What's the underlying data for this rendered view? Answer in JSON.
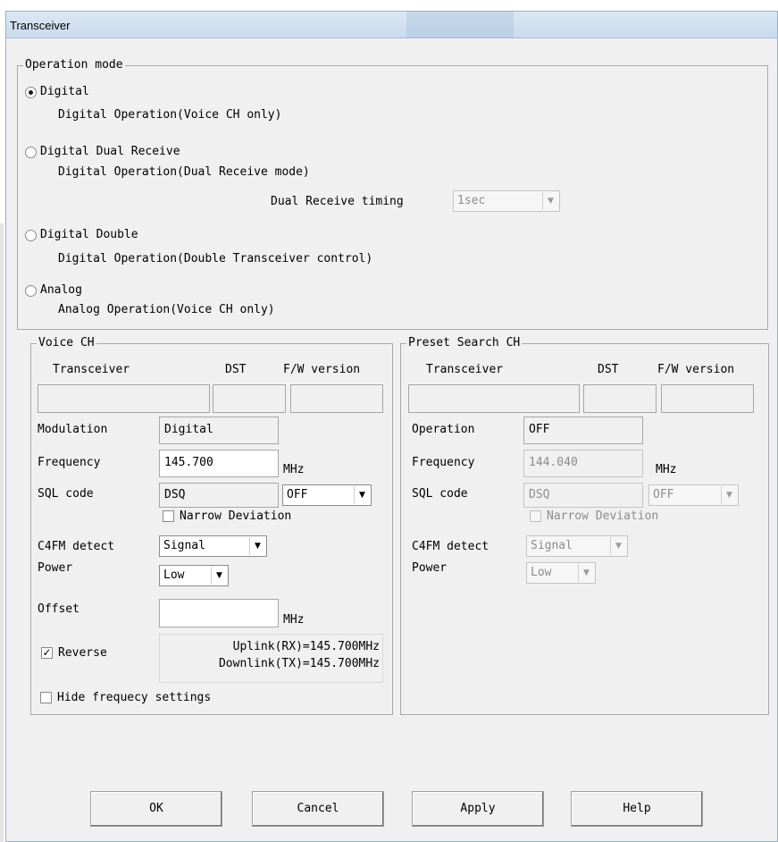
{
  "window": {
    "title": "Transceiver"
  },
  "operation_mode": {
    "legend": "Operation mode",
    "options": [
      {
        "label": "Digital",
        "description": "Digital Operation(Voice CH only)",
        "selected": true
      },
      {
        "label": "Digital Dual Receive",
        "description": "Digital Operation(Dual Receive mode)",
        "selected": false
      },
      {
        "label": "Digital Double",
        "description": "Digital Operation(Double Transceiver control)",
        "selected": false
      },
      {
        "label": "Analog",
        "description": "Analog Operation(Voice CH only)",
        "selected": false
      }
    ],
    "dual_receive_timing": {
      "label": "Dual Receive timing",
      "value": "1sec",
      "enabled": false
    }
  },
  "voice_ch": {
    "legend": "Voice CH",
    "columns": [
      "Transceiver",
      "DST",
      "F/W version"
    ],
    "values": [
      "",
      "",
      ""
    ],
    "modulation": {
      "label": "Modulation",
      "value": "Digital"
    },
    "frequency": {
      "label": "Frequency",
      "value": "145.700",
      "unit": "MHz"
    },
    "sql_code": {
      "label": "SQL code",
      "value": "DSQ",
      "option": "OFF"
    },
    "narrow_deviation": {
      "label": "Narrow Deviation",
      "checked": false
    },
    "c4fm_detect": {
      "label": "C4FM detect",
      "value": "Signal"
    },
    "power": {
      "label": "Power",
      "value": "Low"
    },
    "offset": {
      "label": "Offset",
      "value": "",
      "unit": "MHz"
    },
    "reverse": {
      "label": "Reverse",
      "checked": true
    },
    "uplink": "Uplink(RX)=145.700MHz",
    "downlink": "Downlink(TX)=145.700MHz",
    "hide_frequency": {
      "label": "Hide frequecy settings",
      "checked": false
    }
  },
  "preset_search_ch": {
    "legend": "Preset Search CH",
    "columns": [
      "Transceiver",
      "DST",
      "F/W version"
    ],
    "values": [
      "",
      "",
      ""
    ],
    "operation": {
      "label": "Operation",
      "value": "OFF"
    },
    "frequency": {
      "label": "Frequency",
      "value": "144.040",
      "unit": "MHz"
    },
    "sql_code": {
      "label": "SQL code",
      "value": "DSQ",
      "option": "OFF"
    },
    "narrow_deviation": {
      "label": "Narrow Deviation",
      "checked": false
    },
    "c4fm_detect": {
      "label": "C4FM detect",
      "value": "Signal"
    },
    "power": {
      "label": "Power",
      "value": "Low"
    }
  },
  "buttons": {
    "ok": "OK",
    "cancel": "Cancel",
    "apply": "Apply",
    "help": "Help"
  },
  "icons": {
    "combo_arrow": "chevron-down-icon",
    "check_mark": "check-icon"
  }
}
